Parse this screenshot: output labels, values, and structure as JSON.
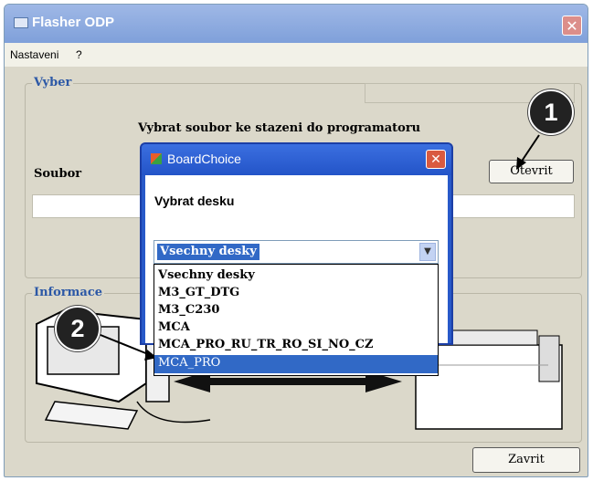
{
  "window": {
    "title": "Flasher ODP",
    "close_glyph": "✕"
  },
  "menu": {
    "items": [
      "Nastaveni",
      "?"
    ]
  },
  "vyber": {
    "label": "Vyber",
    "instruction": "Vybrat soubor ke stazeni do programatoru",
    "file_label": "Soubor",
    "open_button": "Otevrit"
  },
  "informace": {
    "label": "Informace"
  },
  "close_button": "Zavrit",
  "dialog": {
    "title": "BoardChoice",
    "close_glyph": "✕",
    "prompt": "Vybrat desku",
    "selected": "Vsechny desky",
    "options": [
      "Vsechny desky",
      "M3_GT_DTG",
      "M3_C230",
      "MCA",
      "MCA_PRO_RU_TR_RO_SI_NO_CZ",
      "MCA_PRO"
    ],
    "highlighted_option": "MCA_PRO"
  },
  "callouts": [
    "1",
    "2"
  ],
  "colors": {
    "accent": "#2859c9",
    "selection": "#3169c6",
    "group_label": "#2c58a6"
  },
  "icons": [
    "app-icon",
    "close-icon",
    "board-choice-icon",
    "chevron-down-icon",
    "pc-illustration",
    "device-illustration",
    "arrow-icon"
  ]
}
